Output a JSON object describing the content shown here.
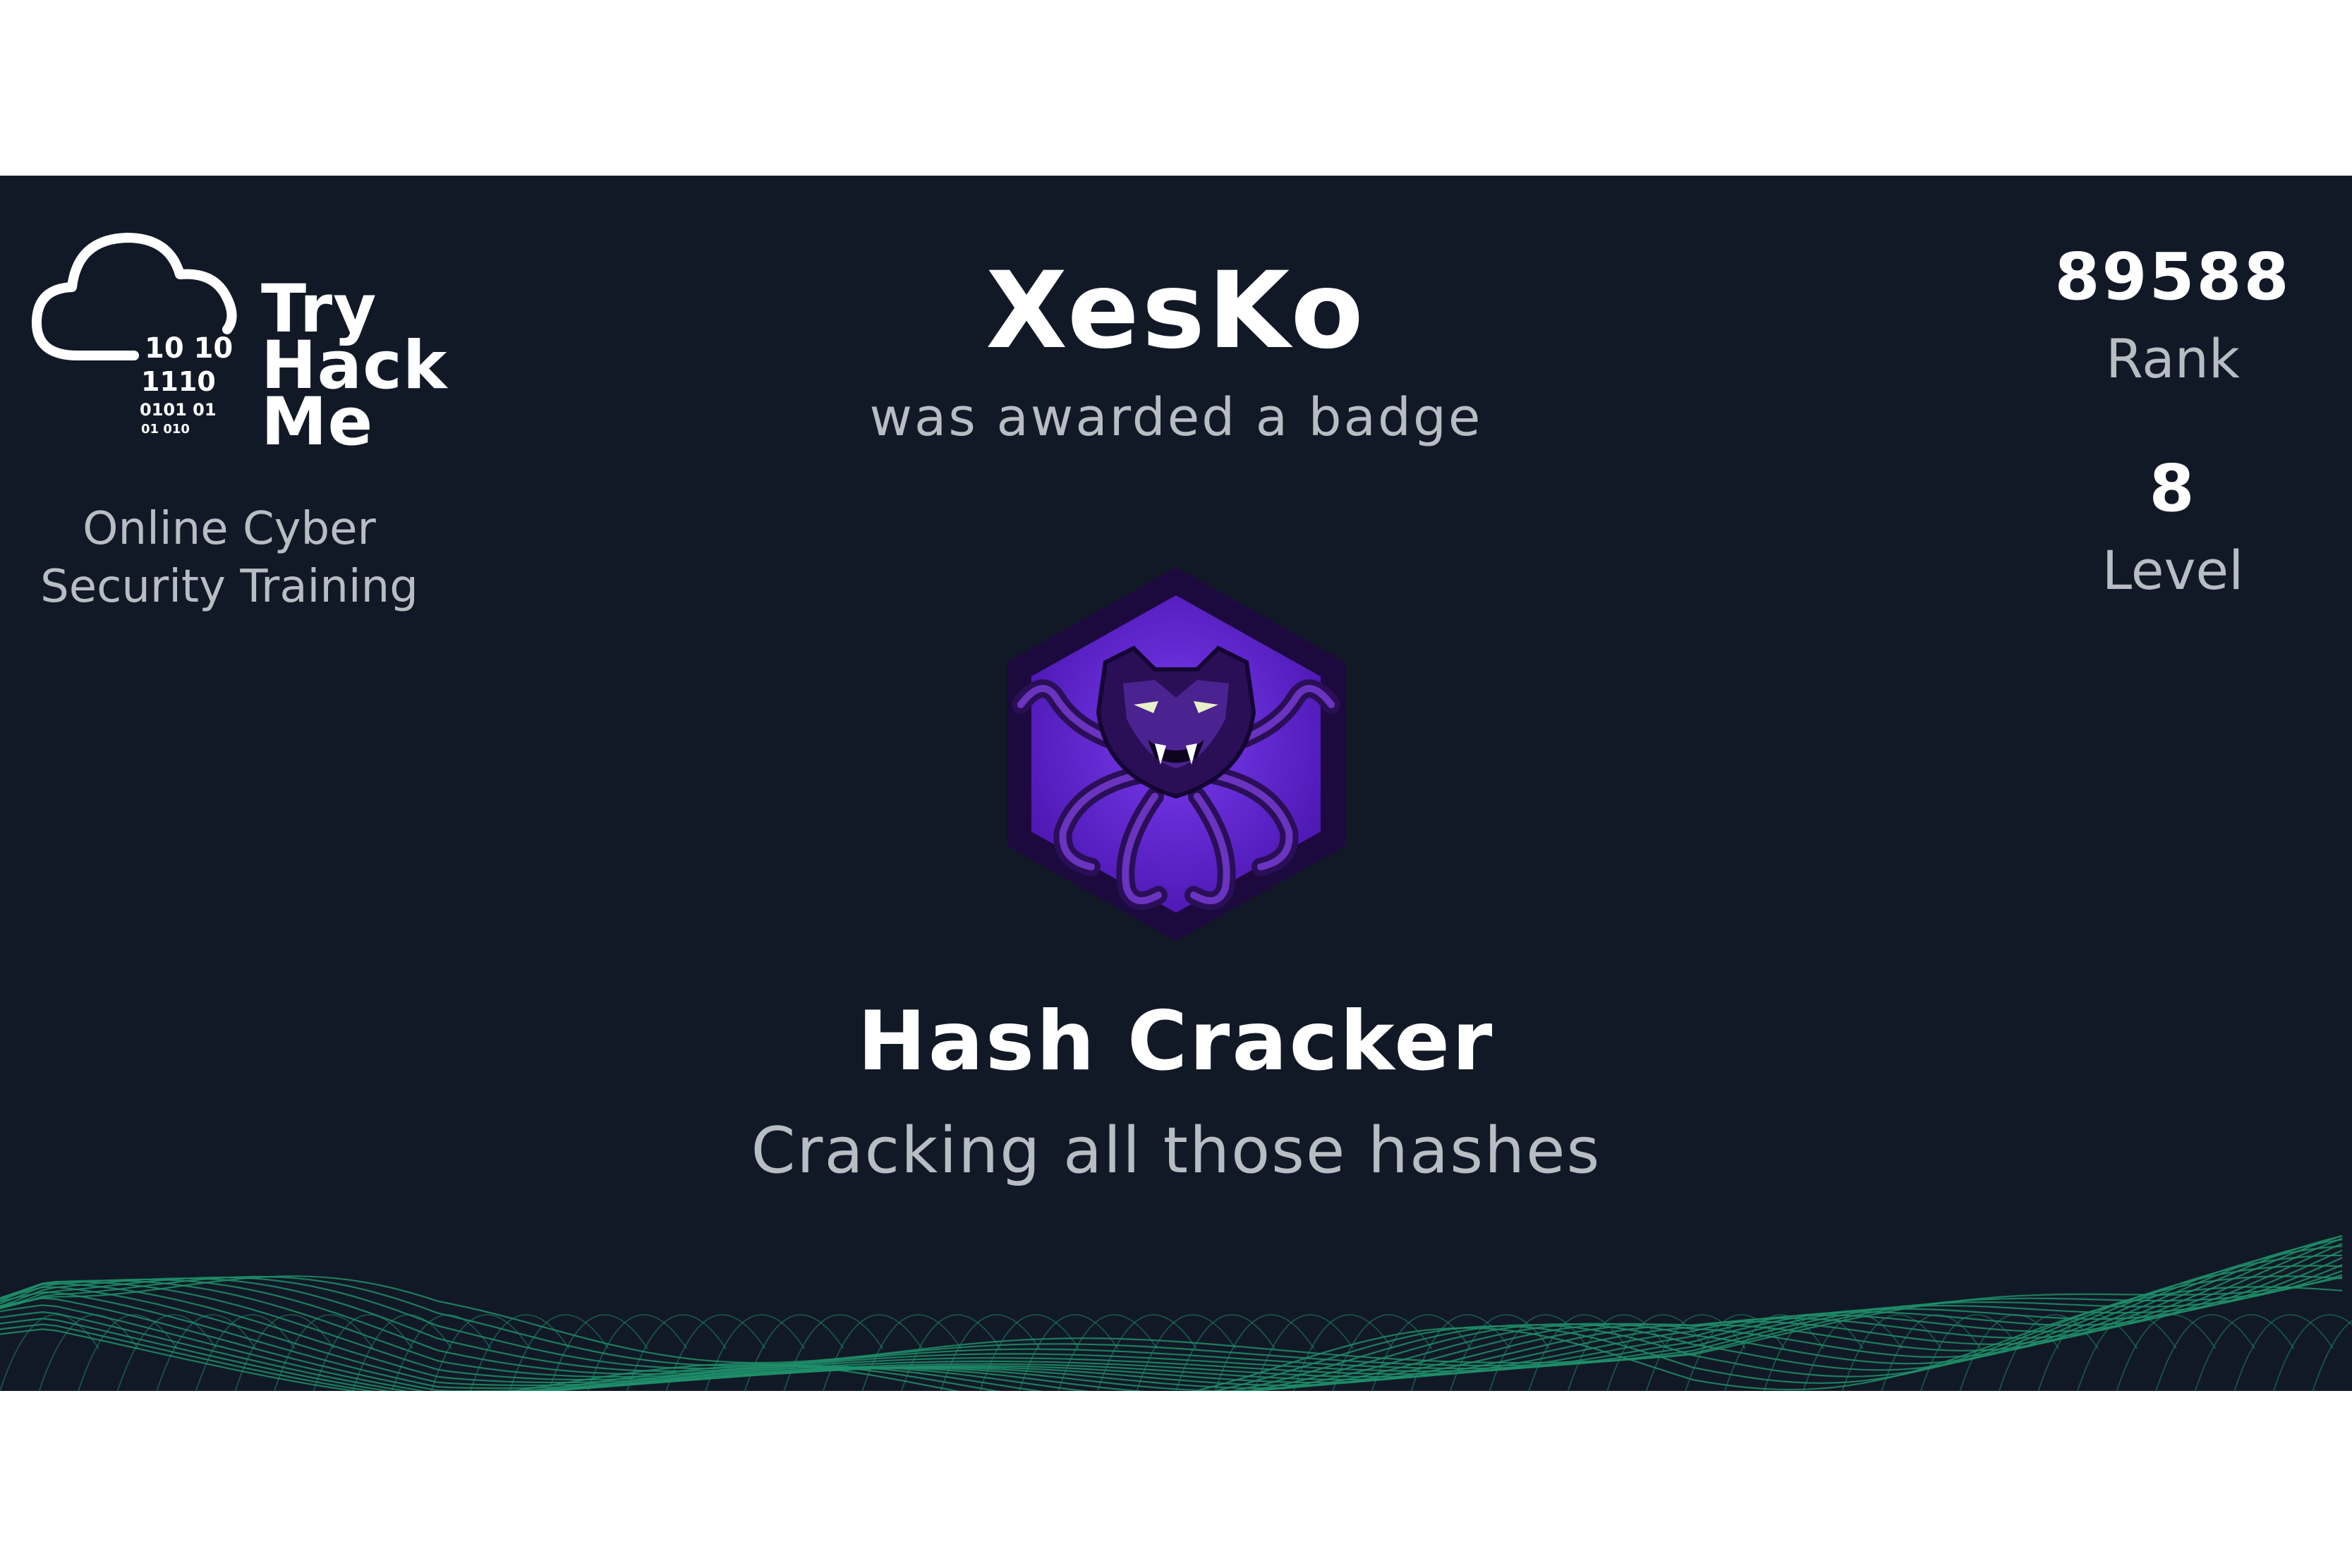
{
  "brand": {
    "logo_words": [
      "Try",
      "Hack",
      "Me"
    ],
    "tagline_lines": [
      "Online Cyber",
      "Security Training"
    ],
    "binary_lines": [
      "10  10",
      "1110",
      "0101  01",
      "01  010"
    ]
  },
  "user": {
    "username": "XesKo",
    "awarded_text": "was awarded a badge"
  },
  "badge": {
    "name": "Hash Cracker",
    "description": "Cracking all those hashes",
    "icon": "tentacle-beast-hexagon-badge"
  },
  "stats": {
    "rank": {
      "value": "89588",
      "label": "Rank"
    },
    "level": {
      "value": "8",
      "label": "Level"
    }
  },
  "colors": {
    "background": "#121926",
    "text_primary": "#ffffff",
    "text_secondary": "#b8bcc3",
    "badge_purple": "#5b1fc7",
    "badge_dark": "#1c0a3e",
    "wave_green": "#1f8f6a"
  }
}
